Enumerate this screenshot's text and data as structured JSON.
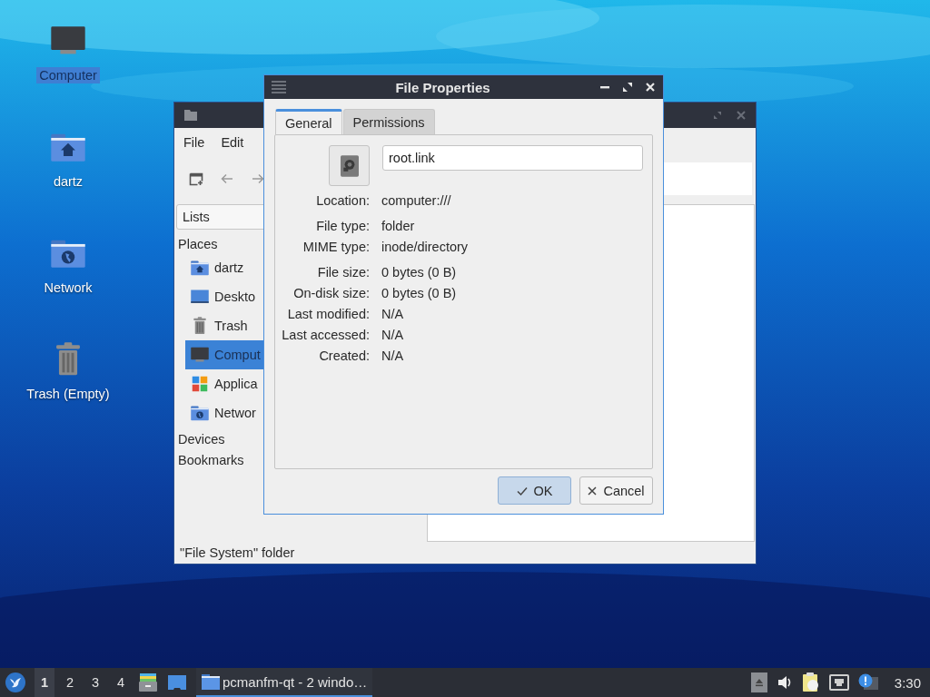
{
  "desktop_icons": [
    {
      "label": "Computer",
      "kind": "computer",
      "selected": true
    },
    {
      "label": "dartz",
      "kind": "home",
      "selected": false
    },
    {
      "label": "Network",
      "kind": "network",
      "selected": false
    },
    {
      "label": "Trash (Empty)",
      "kind": "trash",
      "selected": false
    }
  ],
  "file_manager": {
    "menu": [
      "File",
      "Edit"
    ],
    "side_pane": {
      "view": "Lists",
      "places_title": "Places",
      "places": [
        {
          "label": "dartz",
          "kind": "home",
          "selected": false
        },
        {
          "label": "Deskto",
          "kind": "desktop",
          "selected": false
        },
        {
          "label": "Trash",
          "kind": "trash",
          "selected": false
        },
        {
          "label": "Comput",
          "kind": "computer",
          "selected": true
        },
        {
          "label": "Applica",
          "kind": "apps",
          "selected": false
        },
        {
          "label": "Networ",
          "kind": "network",
          "selected": false
        }
      ],
      "sections": [
        "Devices",
        "Bookmarks"
      ]
    },
    "status_bar": "\"File System\" folder"
  },
  "dialog": {
    "title": "File Properties",
    "tabs": [
      {
        "label": "General",
        "selected": true
      },
      {
        "label": "Permissions",
        "selected": false
      }
    ],
    "name": "root.link",
    "property_groups": [
      [
        {
          "label": "Location:",
          "value": "computer:///"
        }
      ],
      [
        {
          "label": "File type:",
          "value": "folder"
        },
        {
          "label": "MIME type:",
          "value": "inode/directory"
        }
      ],
      [
        {
          "label": "File size:",
          "value": "0 bytes (0 B)"
        },
        {
          "label": "On-disk size:",
          "value": "0 bytes (0 B)"
        },
        {
          "label": "Last modified:",
          "value": "N/A"
        },
        {
          "label": "Last accessed:",
          "value": "N/A"
        },
        {
          "label": "Created:",
          "value": "N/A"
        }
      ]
    ],
    "buttons": [
      {
        "label": "OK",
        "kind": "ok",
        "default": true
      },
      {
        "label": "Cancel",
        "kind": "cancel",
        "default": false
      }
    ]
  },
  "taskbar": {
    "desktops": [
      {
        "label": "1",
        "selected": true
      },
      {
        "label": "2",
        "selected": false
      },
      {
        "label": "3",
        "selected": false
      },
      {
        "label": "4",
        "selected": false
      }
    ],
    "task": "pcmanfm-qt - 2 windo…",
    "clock": "3:30"
  }
}
